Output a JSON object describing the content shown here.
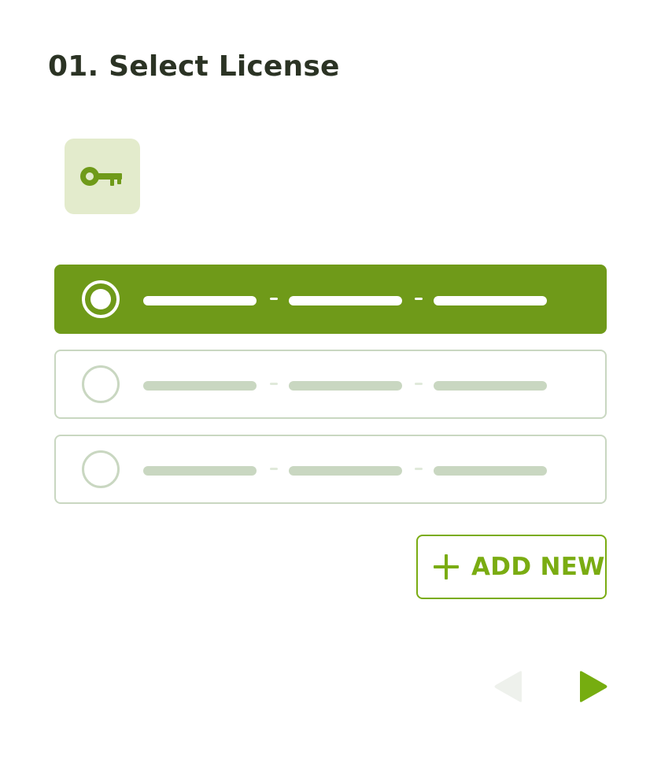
{
  "header": {
    "title": "01. Select License"
  },
  "key_tile": {
    "icon": "key-icon",
    "tile_color": "#e3ebcc",
    "icon_color": "#6f9a19"
  },
  "licenses": {
    "selected_index": 0,
    "items": [
      {
        "state": "selected"
      },
      {
        "state": "unselected"
      },
      {
        "state": "unselected"
      }
    ]
  },
  "actions": {
    "add_new_label": "ADD NEW",
    "add_new_icon": "plus-icon",
    "accent_color": "#7aac12"
  },
  "navigation": {
    "prev_icon": "triangle-left-icon",
    "prev_enabled": false,
    "next_icon": "triangle-right-icon",
    "next_enabled": true
  },
  "colors": {
    "selected_bg": "#6f9a19",
    "placeholder": "#c9d7c1",
    "title": "#2b3324",
    "disabled": "#eef1ec"
  }
}
